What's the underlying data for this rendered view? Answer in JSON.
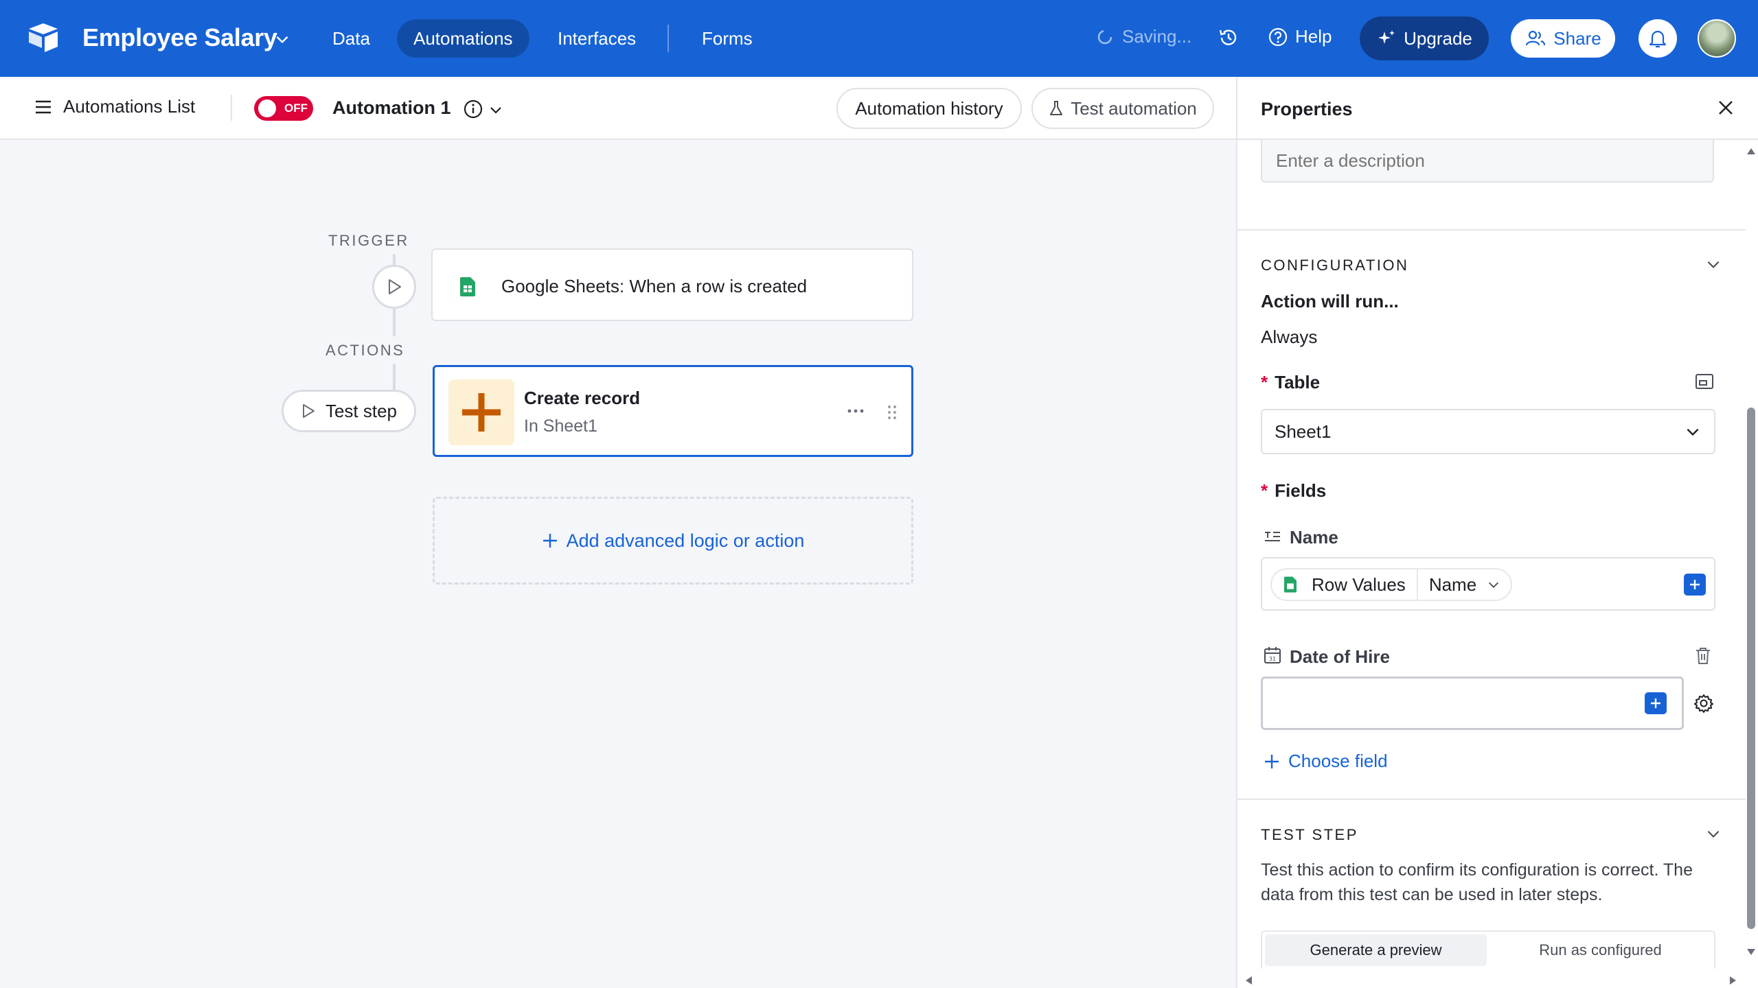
{
  "topbar": {
    "base_title": "Employee Salary",
    "tabs": [
      {
        "label": "Data",
        "active": false
      },
      {
        "label": "Automations",
        "active": true
      },
      {
        "label": "Interfaces",
        "active": false
      },
      {
        "label": "Forms",
        "active": false
      }
    ],
    "saving_label": "Saving...",
    "help_label": "Help",
    "upgrade_label": "Upgrade",
    "share_label": "Share",
    "colors": {
      "bar": "#1763d6",
      "upgrade_bg": "#0f3d8c"
    }
  },
  "subbar": {
    "automations_list_label": "Automations List",
    "toggle_label": "OFF",
    "toggle_color": "#dc043b",
    "automation_name": "Automation 1",
    "history_button": "Automation history",
    "test_button": "Test automation"
  },
  "canvas": {
    "trigger_label": "TRIGGER",
    "trigger_card": "Google Sheets: When a row is created",
    "actions_label": "ACTIONS",
    "test_step_button": "Test step",
    "action_card": {
      "title": "Create record",
      "subtitle": "In Sheet1"
    },
    "add_logic_label": "Add advanced logic or action"
  },
  "panel": {
    "title": "Properties",
    "description_placeholder": "Enter a description",
    "configuration_label": "CONFIGURATION",
    "action_will_run_label": "Action will run...",
    "action_will_run_value": "Always",
    "table_label": "Table",
    "table_value": "Sheet1",
    "fields_label": "Fields",
    "field_name": {
      "label": "Name",
      "chip_source": "Row Values",
      "chip_field": "Name"
    },
    "field_date": {
      "label": "Date of Hire",
      "value": ""
    },
    "choose_field_label": "Choose field",
    "test_step_label": "TEST STEP",
    "test_step_description": "Test this action to confirm its configuration is correct. The data from this test can be used in later steps.",
    "test_tabs": [
      {
        "label": "Generate a preview",
        "active": true
      },
      {
        "label": "Run as configured",
        "active": false
      }
    ]
  }
}
